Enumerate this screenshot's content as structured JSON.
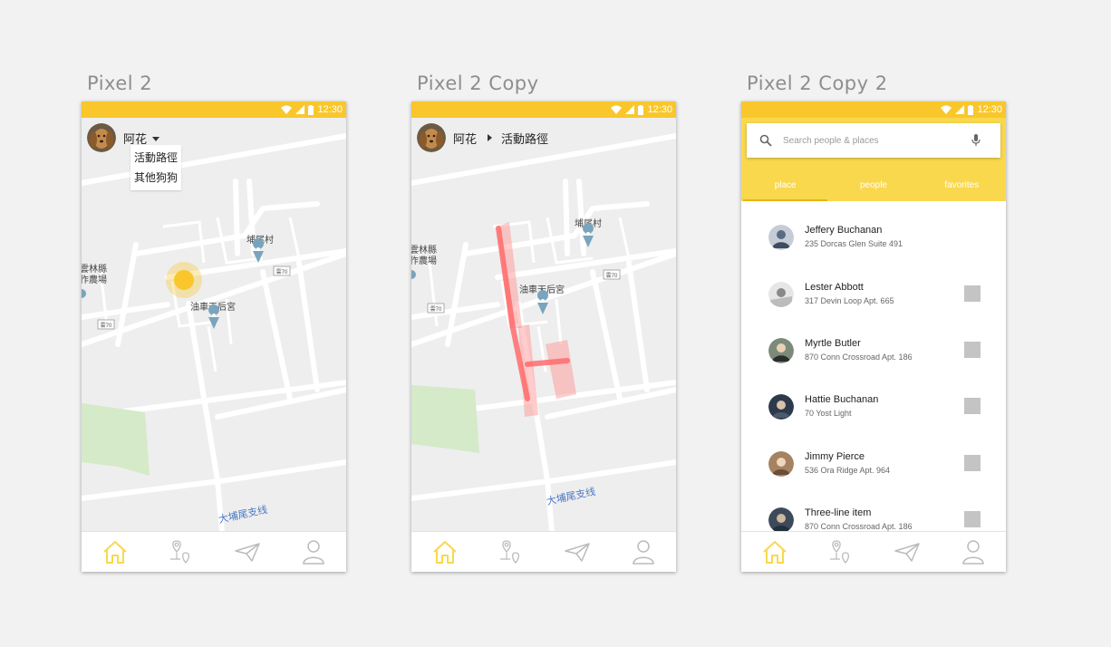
{
  "artboards": [
    {
      "title": "Pixel 2"
    },
    {
      "title": "Pixel 2 Copy"
    },
    {
      "title": "Pixel 2 Copy 2"
    }
  ],
  "status_bar": {
    "time": "12:30",
    "color": "#f9c72b"
  },
  "user": {
    "name": "阿花"
  },
  "dropdown": {
    "items": [
      "活動路徑",
      "其他狗狗"
    ]
  },
  "route": {
    "label": "活動路徑"
  },
  "map_labels": {
    "village": "埔尾村",
    "temple": "油車天后宮",
    "farm_line1": "雲林縣",
    "farm_line2": "作農場",
    "farm2_line1": "雲林縣",
    "farm2_line2": "作農場",
    "road_sign": "雲70",
    "branch_line": "大埔尾支线"
  },
  "search": {
    "placeholder": "Search people & places"
  },
  "tabs": [
    "place",
    "people",
    "favorites"
  ],
  "people": [
    {
      "name": "Jeffery Buchanan",
      "address": "235 Dorcas Glen Suite 491",
      "has_checkbox": false
    },
    {
      "name": "Lester Abbott",
      "address": "317 Devin Loop Apt. 665",
      "has_checkbox": true
    },
    {
      "name": "Myrtle Butler",
      "address": "870 Conn Crossroad Apt. 186",
      "has_checkbox": true
    },
    {
      "name": "Hattie Buchanan",
      "address": "70 Yost Light",
      "has_checkbox": true
    },
    {
      "name": "Jimmy Pierce",
      "address": "536 Ora Ridge Apt. 964",
      "has_checkbox": true
    },
    {
      "name": "Three-line item",
      "address": "870 Conn Crossroad Apt. 186",
      "has_checkbox": true
    }
  ],
  "nav_icons": [
    "home-icon",
    "places-icon",
    "send-icon",
    "profile-icon"
  ],
  "colors": {
    "accent": "#f9c72b",
    "header_yellow": "#f9d84e",
    "route_red": "#ff6b6b",
    "location_dot": "#f9c72b"
  }
}
